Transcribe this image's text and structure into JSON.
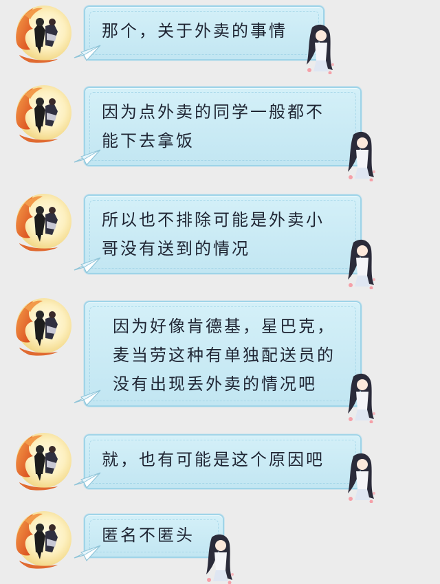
{
  "chat": {
    "messages": [
      {
        "text": "那个，关于外卖的事情"
      },
      {
        "text": "因为点外卖的同学一般都不\n能下去拿饭"
      },
      {
        "text": "所以也不排除可能是外卖小\n哥没有送到的情况"
      },
      {
        "text": "因为好像肯德基，星巴克，\n麦当劳这种有单独配送员的\n没有出现丢外卖的情况吧"
      },
      {
        "text": "就，也有可能是这个原因吧"
      },
      {
        "text": "匿名不匿头"
      }
    ]
  },
  "icons": {
    "avatar": "sender-avatar",
    "bubble_decoration": "paper-plane-icon",
    "bubble_character": "girl-character-icon"
  },
  "colors": {
    "background": "#ececec",
    "bubble_fill": "#c9ebf5",
    "bubble_border": "#9fd4e8",
    "text": "#1f2533",
    "avatar_fire": "#e8642a",
    "avatar_moon": "#fff5c8"
  }
}
